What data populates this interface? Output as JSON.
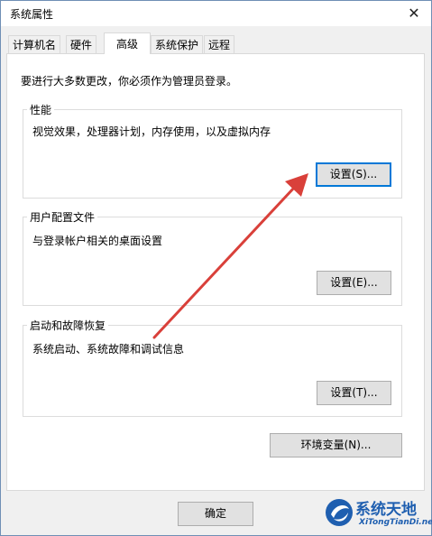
{
  "window": {
    "title": "系统属性",
    "close_glyph": "✕"
  },
  "tabs": [
    {
      "label": "计算机名",
      "active": false
    },
    {
      "label": "硬件",
      "active": false
    },
    {
      "label": "高级",
      "active": true
    },
    {
      "label": "系统保护",
      "active": false
    },
    {
      "label": "远程",
      "active": false
    }
  ],
  "notice": "要进行大多数更改，你必须作为管理员登录。",
  "performance": {
    "title": "性能",
    "desc": "视觉效果，处理器计划，内存使用，以及虚拟内存",
    "button": "设置(S)..."
  },
  "user_profiles": {
    "title": "用户配置文件",
    "desc": "与登录帐户相关的桌面设置",
    "button": "设置(E)..."
  },
  "startup_recovery": {
    "title": "启动和故障恢复",
    "desc": "系统启动、系统故障和调试信息",
    "button": "设置(T)..."
  },
  "env_button": "环境变量(N)...",
  "ok_button": "确定",
  "watermark": {
    "name_cn": "系统天地",
    "name_en": "XiTongTianDi.net"
  },
  "colors": {
    "arrow": "#d9403a",
    "focus": "#0078d7",
    "logo": "#1f5fb0"
  },
  "icons": {
    "close": "close-icon",
    "logo": "watermark-logo-icon",
    "arrow": "annotation-arrow"
  }
}
